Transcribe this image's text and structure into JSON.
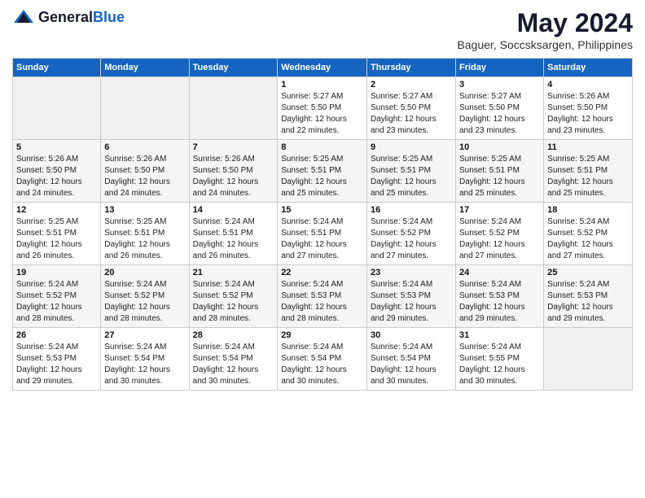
{
  "header": {
    "logo_general": "General",
    "logo_blue": "Blue",
    "title": "May 2024",
    "subtitle": "Baguer, Soccsksargen, Philippines"
  },
  "days_of_week": [
    "Sunday",
    "Monday",
    "Tuesday",
    "Wednesday",
    "Thursday",
    "Friday",
    "Saturday"
  ],
  "weeks": [
    [
      {
        "day": "",
        "info": ""
      },
      {
        "day": "",
        "info": ""
      },
      {
        "day": "",
        "info": ""
      },
      {
        "day": "1",
        "info": "Sunrise: 5:27 AM\nSunset: 5:50 PM\nDaylight: 12 hours\nand 22 minutes."
      },
      {
        "day": "2",
        "info": "Sunrise: 5:27 AM\nSunset: 5:50 PM\nDaylight: 12 hours\nand 23 minutes."
      },
      {
        "day": "3",
        "info": "Sunrise: 5:27 AM\nSunset: 5:50 PM\nDaylight: 12 hours\nand 23 minutes."
      },
      {
        "day": "4",
        "info": "Sunrise: 5:26 AM\nSunset: 5:50 PM\nDaylight: 12 hours\nand 23 minutes."
      }
    ],
    [
      {
        "day": "5",
        "info": "Sunrise: 5:26 AM\nSunset: 5:50 PM\nDaylight: 12 hours\nand 24 minutes."
      },
      {
        "day": "6",
        "info": "Sunrise: 5:26 AM\nSunset: 5:50 PM\nDaylight: 12 hours\nand 24 minutes."
      },
      {
        "day": "7",
        "info": "Sunrise: 5:26 AM\nSunset: 5:50 PM\nDaylight: 12 hours\nand 24 minutes."
      },
      {
        "day": "8",
        "info": "Sunrise: 5:25 AM\nSunset: 5:51 PM\nDaylight: 12 hours\nand 25 minutes."
      },
      {
        "day": "9",
        "info": "Sunrise: 5:25 AM\nSunset: 5:51 PM\nDaylight: 12 hours\nand 25 minutes."
      },
      {
        "day": "10",
        "info": "Sunrise: 5:25 AM\nSunset: 5:51 PM\nDaylight: 12 hours\nand 25 minutes."
      },
      {
        "day": "11",
        "info": "Sunrise: 5:25 AM\nSunset: 5:51 PM\nDaylight: 12 hours\nand 25 minutes."
      }
    ],
    [
      {
        "day": "12",
        "info": "Sunrise: 5:25 AM\nSunset: 5:51 PM\nDaylight: 12 hours\nand 26 minutes."
      },
      {
        "day": "13",
        "info": "Sunrise: 5:25 AM\nSunset: 5:51 PM\nDaylight: 12 hours\nand 26 minutes."
      },
      {
        "day": "14",
        "info": "Sunrise: 5:24 AM\nSunset: 5:51 PM\nDaylight: 12 hours\nand 26 minutes."
      },
      {
        "day": "15",
        "info": "Sunrise: 5:24 AM\nSunset: 5:51 PM\nDaylight: 12 hours\nand 27 minutes."
      },
      {
        "day": "16",
        "info": "Sunrise: 5:24 AM\nSunset: 5:52 PM\nDaylight: 12 hours\nand 27 minutes."
      },
      {
        "day": "17",
        "info": "Sunrise: 5:24 AM\nSunset: 5:52 PM\nDaylight: 12 hours\nand 27 minutes."
      },
      {
        "day": "18",
        "info": "Sunrise: 5:24 AM\nSunset: 5:52 PM\nDaylight: 12 hours\nand 27 minutes."
      }
    ],
    [
      {
        "day": "19",
        "info": "Sunrise: 5:24 AM\nSunset: 5:52 PM\nDaylight: 12 hours\nand 28 minutes."
      },
      {
        "day": "20",
        "info": "Sunrise: 5:24 AM\nSunset: 5:52 PM\nDaylight: 12 hours\nand 28 minutes."
      },
      {
        "day": "21",
        "info": "Sunrise: 5:24 AM\nSunset: 5:52 PM\nDaylight: 12 hours\nand 28 minutes."
      },
      {
        "day": "22",
        "info": "Sunrise: 5:24 AM\nSunset: 5:53 PM\nDaylight: 12 hours\nand 28 minutes."
      },
      {
        "day": "23",
        "info": "Sunrise: 5:24 AM\nSunset: 5:53 PM\nDaylight: 12 hours\nand 29 minutes."
      },
      {
        "day": "24",
        "info": "Sunrise: 5:24 AM\nSunset: 5:53 PM\nDaylight: 12 hours\nand 29 minutes."
      },
      {
        "day": "25",
        "info": "Sunrise: 5:24 AM\nSunset: 5:53 PM\nDaylight: 12 hours\nand 29 minutes."
      }
    ],
    [
      {
        "day": "26",
        "info": "Sunrise: 5:24 AM\nSunset: 5:53 PM\nDaylight: 12 hours\nand 29 minutes."
      },
      {
        "day": "27",
        "info": "Sunrise: 5:24 AM\nSunset: 5:54 PM\nDaylight: 12 hours\nand 30 minutes."
      },
      {
        "day": "28",
        "info": "Sunrise: 5:24 AM\nSunset: 5:54 PM\nDaylight: 12 hours\nand 30 minutes."
      },
      {
        "day": "29",
        "info": "Sunrise: 5:24 AM\nSunset: 5:54 PM\nDaylight: 12 hours\nand 30 minutes."
      },
      {
        "day": "30",
        "info": "Sunrise: 5:24 AM\nSunset: 5:54 PM\nDaylight: 12 hours\nand 30 minutes."
      },
      {
        "day": "31",
        "info": "Sunrise: 5:24 AM\nSunset: 5:55 PM\nDaylight: 12 hours\nand 30 minutes."
      },
      {
        "day": "",
        "info": ""
      }
    ]
  ]
}
